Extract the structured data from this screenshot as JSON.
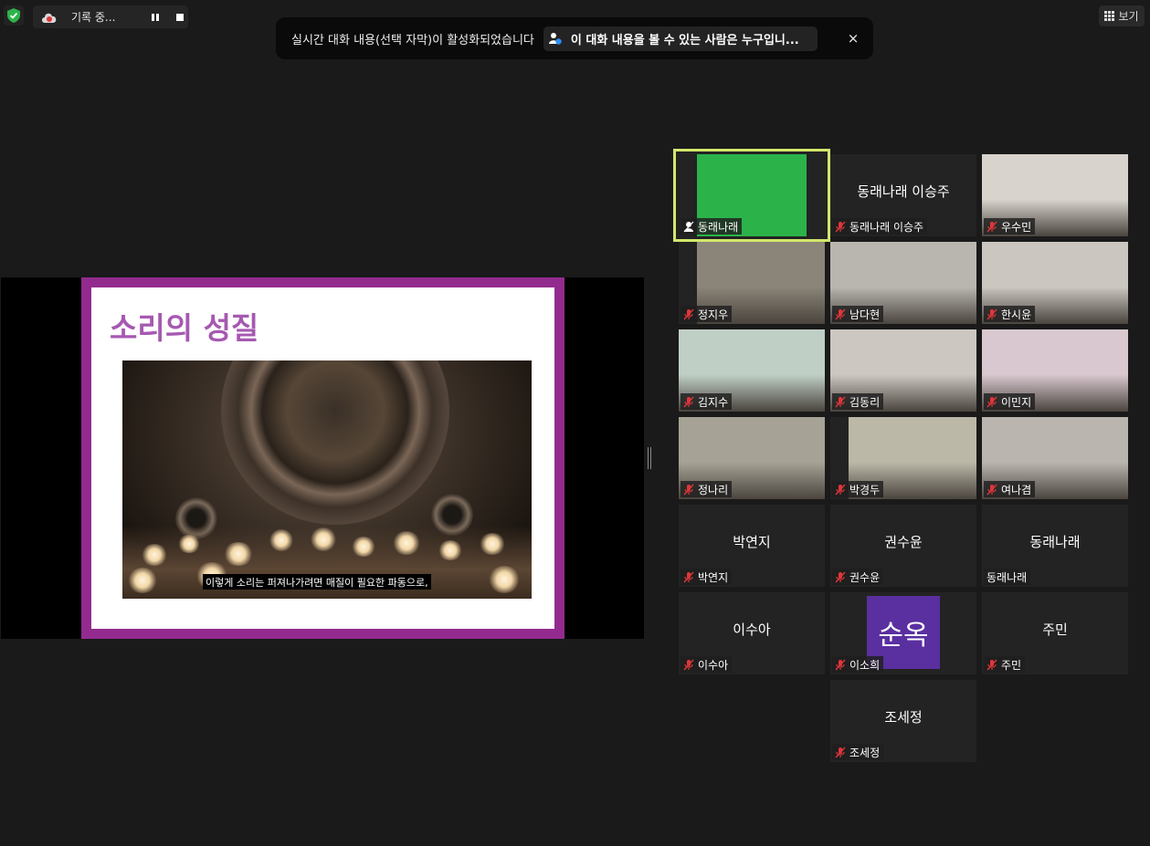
{
  "recording": {
    "label": "기록 중..."
  },
  "view": {
    "label": "보기"
  },
  "notification": {
    "message": "실시간 대화 내용(선택 자막)이 활성화되었습니다",
    "link": "이 대화 내용을 볼 수 있는 사람은 누구입니...",
    "close": "×"
  },
  "slide": {
    "title": "소리의 성질",
    "subtitle": "이렇게 소리는 퍼져나가려면 매질이 필요한 파동으로,"
  },
  "tiles": [
    {
      "label": "동래나래",
      "center": "",
      "video": "#2bb34a"
    },
    {
      "label": "동래나래 이승주",
      "center": "동래나래 이승주"
    },
    {
      "label": "우수민",
      "center": "",
      "video": "#d8d3cd"
    },
    {
      "label": "정지우",
      "center": "",
      "video": "#8b8478"
    },
    {
      "label": "남다현",
      "center": "",
      "video": "#b9b6b0"
    },
    {
      "label": "한시윤",
      "center": "",
      "video": "#cbc6c0"
    },
    {
      "label": "김지수",
      "center": "",
      "video": "#bfcfc5"
    },
    {
      "label": "김동리",
      "center": "",
      "video": "#ccc7c0"
    },
    {
      "label": "이민지",
      "center": "",
      "video": "#d9c8cf"
    },
    {
      "label": "정나리",
      "center": "",
      "video": "#a6a295"
    },
    {
      "label": "박경두",
      "center": "",
      "video": "#bcb8a8"
    },
    {
      "label": "여나겸",
      "center": "",
      "video": "#bbb5b0"
    },
    {
      "label": "박연지",
      "center": "박연지"
    },
    {
      "label": "권수윤",
      "center": "권수윤"
    },
    {
      "label": "동래나래",
      "center": "동래나래"
    },
    {
      "label": "이수아",
      "center": "이수아"
    },
    {
      "label": "이소희",
      "avatar": "순옥"
    },
    {
      "label": "주민",
      "center": "주민"
    },
    {
      "label": "조세정",
      "center": "조세정"
    }
  ],
  "colors": {
    "active_border": "#d2e86c",
    "muted_icon": "#e0363a",
    "avatar_bg": "#5a2fa0"
  }
}
